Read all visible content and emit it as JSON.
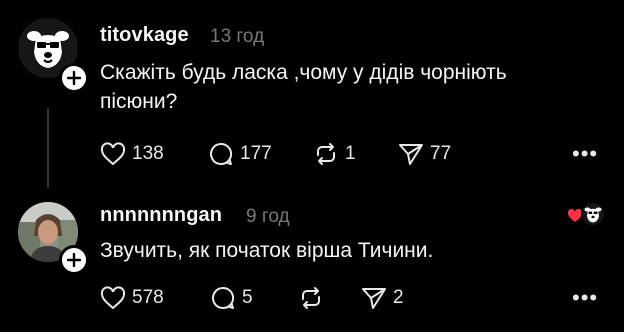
{
  "posts": [
    {
      "username": "titovkage",
      "time": "13 год",
      "text_line1": "Скажіть будь ласка ,чому у дідів чорніють",
      "text_line2": "пісюни?",
      "likes": "138",
      "comments": "177",
      "reposts": "1",
      "shares": "77",
      "avatar_icon": "dog-logo-icon"
    },
    {
      "username": "nnnnnnngan",
      "time": "9 год",
      "text_line1": "Звучить, як початок вірша Тичини.",
      "likes": "578",
      "comments": "5",
      "reposts": "",
      "shares": "2",
      "avatar_icon": "user-photo",
      "liked_by_author": true
    }
  ],
  "more_label": "•••",
  "colors": {
    "bg": "#000000",
    "text": "#f3f5f7",
    "muted": "#777777",
    "heart": "#ff3040"
  }
}
